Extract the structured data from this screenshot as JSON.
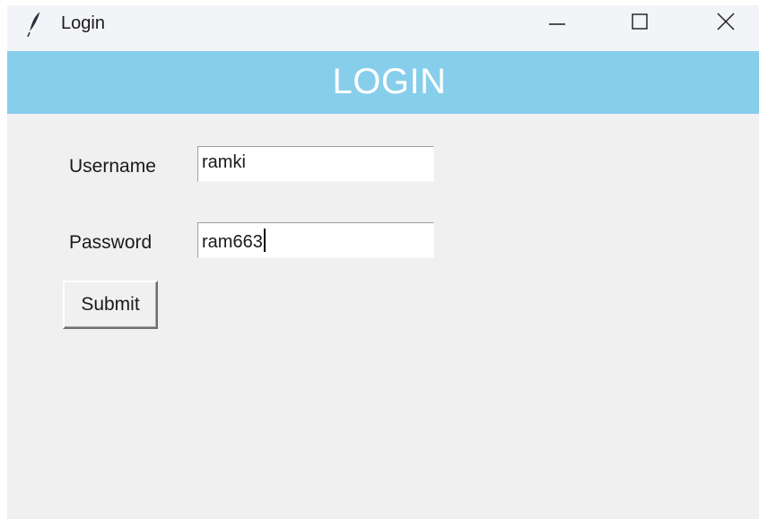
{
  "window": {
    "title": "Login",
    "icon": "feather-icon",
    "controls": [
      "minimize-icon",
      "maximize-icon",
      "close-icon"
    ]
  },
  "banner": {
    "text": "LOGIN",
    "background": "#87ceeb",
    "color": "#ffffff"
  },
  "form": {
    "username_label": "Username",
    "username_value": "ramki",
    "password_label": "Password",
    "password_value": "ram663",
    "submit_label": "Submit"
  }
}
